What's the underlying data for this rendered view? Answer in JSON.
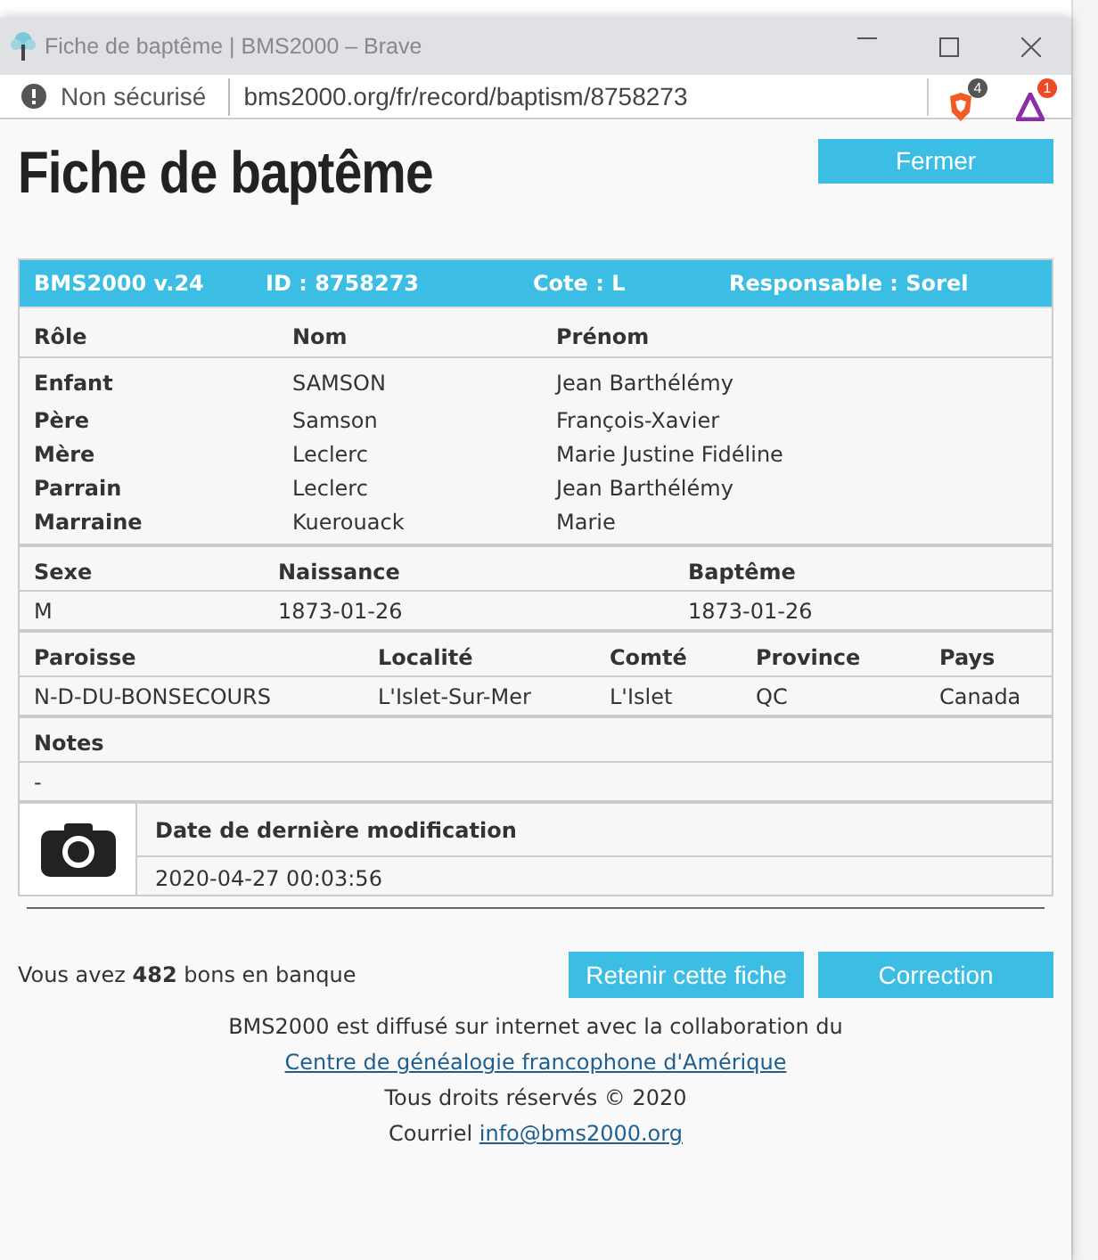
{
  "window": {
    "title": "Fiche de baptême | BMS2000 – Brave"
  },
  "address_bar": {
    "security": "Non sécurisé",
    "url": "bms2000.org/fr/record/baptism/8758273",
    "shields_count": "4",
    "rewards_count": "1"
  },
  "page": {
    "title": "Fiche de baptême",
    "close_button": "Fermer"
  },
  "record": {
    "header": [
      "BMS2000 v.24",
      "ID : 8758273",
      "Cote : L",
      "Responsable : Sorel"
    ],
    "sections": [
      {
        "kind": "persons",
        "columns": [
          "Rôle",
          "Nom",
          "Prénom"
        ],
        "rows": [
          [
            "Enfant",
            "SAMSON",
            "Jean Barthélémy"
          ],
          [
            "Père",
            "Samson",
            "François-Xavier"
          ],
          [
            "Mère",
            "Leclerc",
            "Marie Justine Fidéline"
          ],
          [
            "Parrain",
            "Leclerc",
            "Jean Barthélémy"
          ],
          [
            "Marraine",
            "Kuerouack",
            "Marie"
          ]
        ]
      },
      {
        "kind": "dates",
        "columns": [
          "Sexe",
          "Naissance",
          "Baptême"
        ],
        "rows": [
          [
            "M",
            "1873-01-26",
            "1873-01-26"
          ]
        ]
      },
      {
        "kind": "place",
        "columns": [
          "Paroisse",
          "Localité",
          "Comté",
          "Province",
          "Pays"
        ],
        "rows": [
          [
            "N-D-DU-BONSECOURS",
            "L'Islet-Sur-Mer",
            "L'Islet",
            "QC",
            "Canada"
          ]
        ]
      },
      {
        "kind": "notes",
        "columns": [
          "Notes"
        ],
        "rows": [
          [
            "-"
          ]
        ]
      }
    ],
    "modified": {
      "heading": "Date de dernière modification",
      "value": "2020-04-27 00:03:56"
    }
  },
  "bank": "Vous avez **482** bons en banque",
  "buttons": [
    "Retenir cette fiche",
    "Correction"
  ],
  "footer": [
    [
      {
        "kind": "text",
        "text": "BMS2000 est diffusé sur internet avec la collaboration du"
      }
    ],
    [
      {
        "kind": "link",
        "text": "Centre de généalogie francophone d'Amérique"
      }
    ],
    [
      {
        "kind": "text",
        "text": "Tous droits réservés © 2020"
      }
    ],
    [
      {
        "kind": "text",
        "text": "Courriel"
      },
      {
        "kind": "link",
        "text": "info@bms2000.org"
      }
    ]
  ]
}
